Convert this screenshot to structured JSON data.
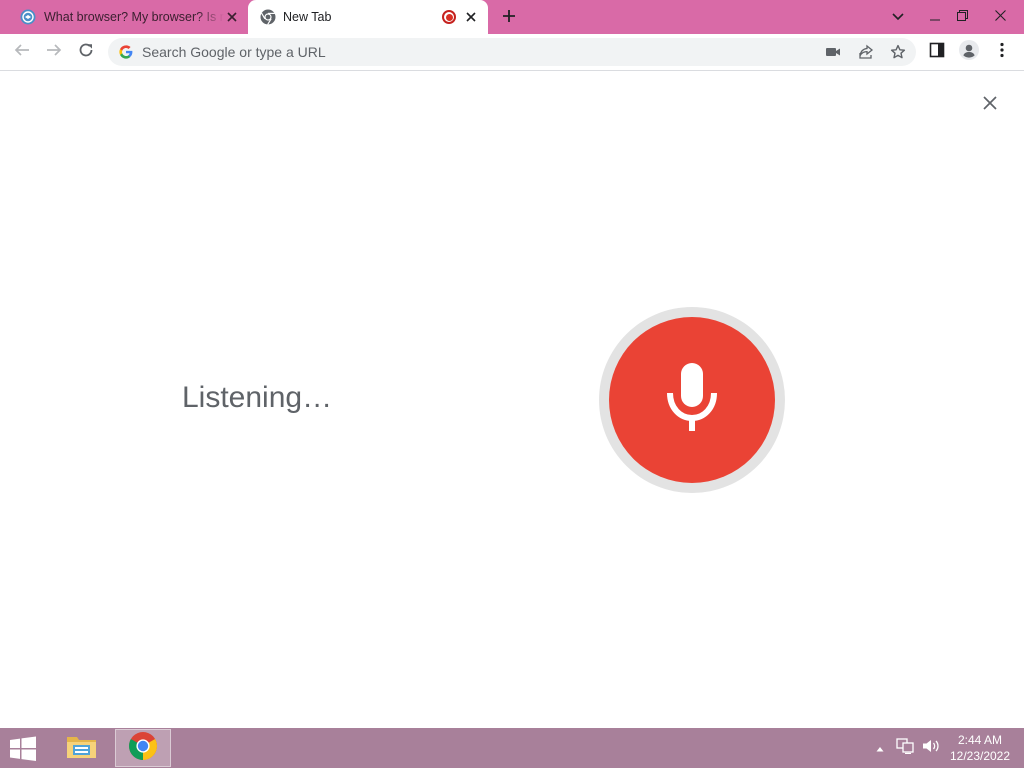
{
  "tabs": [
    {
      "title": "What browser? My browser? Is m",
      "active": false
    },
    {
      "title": "New Tab",
      "active": true
    }
  ],
  "omnibox": {
    "placeholder": "Search Google or type a URL"
  },
  "voice_search": {
    "status": "Listening…"
  },
  "taskbar": {
    "time": "2:44 AM",
    "date": "12/23/2022"
  },
  "colors": {
    "tabstrip": "#d96aa7",
    "mic_red": "#ea4335",
    "mic_ring": "#e3e3e3",
    "taskbar": "#a8809a",
    "text_grey": "#5f6368"
  },
  "icons": [
    "whatbrowser-favicon",
    "chrome-favicon",
    "recording-icon",
    "close-icon",
    "plus-icon",
    "chevron-down-icon",
    "minimize-icon",
    "restore-icon",
    "back-icon",
    "forward-icon",
    "reload-icon",
    "google-g-icon",
    "camera-icon",
    "share-icon",
    "star-icon",
    "side-panel-icon",
    "profile-icon",
    "kebab-menu-icon",
    "microphone-icon",
    "windows-start-icon",
    "file-explorer-icon",
    "chrome-taskbar-icon",
    "tray-arrow-icon",
    "network-icon",
    "volume-icon"
  ]
}
